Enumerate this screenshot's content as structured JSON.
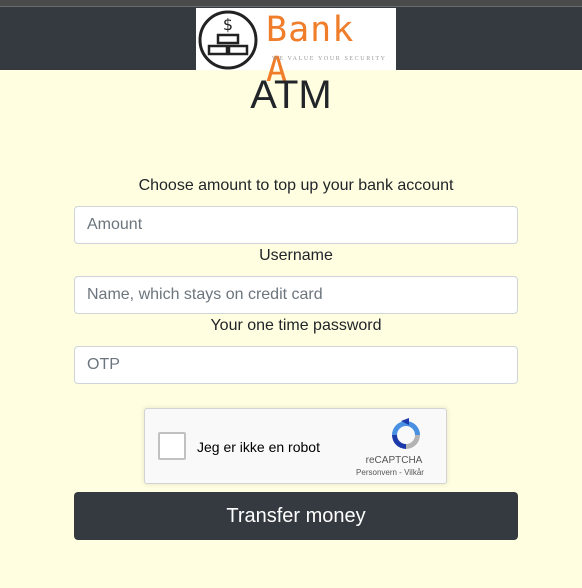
{
  "header": {
    "brand_name": "Bank A",
    "brand_tagline": "WE VALUE YOUR SECURITY"
  },
  "page": {
    "title": "ATM"
  },
  "form": {
    "amount_label": "Choose amount to top up your bank account",
    "amount_placeholder": "Amount",
    "username_label": "Username",
    "username_placeholder": "Name, which stays on credit card",
    "otp_label": "Your one time password",
    "otp_placeholder": "OTP",
    "submit_label": "Transfer money"
  },
  "captcha": {
    "checkbox_label": "Jeg er ikke en robot",
    "brand": "reCAPTCHA",
    "links": "Personvern - Vilkår",
    "checked": false
  },
  "colors": {
    "page_background": "#fffee0",
    "navbar": "#343a40",
    "logo_accent": "#f07d2a",
    "button": "#343a40"
  }
}
